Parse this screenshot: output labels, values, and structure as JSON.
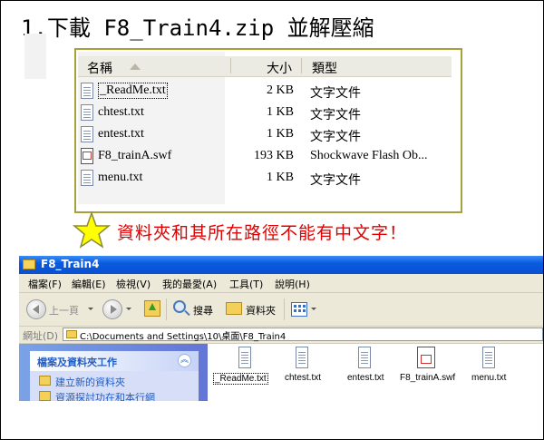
{
  "heading": "1.下載 F8_Train4.zip 並解壓縮",
  "file_list": {
    "columns": {
      "name": "名稱",
      "size": "大小",
      "type": "類型"
    },
    "rows": [
      {
        "name": "_ReadMe.txt",
        "size": "2 KB",
        "type": "文字文件",
        "icon": "text-file-icon"
      },
      {
        "name": "chtest.txt",
        "size": "1 KB",
        "type": "文字文件",
        "icon": "text-file-icon"
      },
      {
        "name": "entest.txt",
        "size": "1 KB",
        "type": "文字文件",
        "icon": "text-file-icon"
      },
      {
        "name": "F8_trainA.swf",
        "size": "193 KB",
        "type": "Shockwave Flash Ob...",
        "icon": "flash-file-icon"
      },
      {
        "name": "menu.txt",
        "size": "1 KB",
        "type": "文字文件",
        "icon": "text-file-icon"
      }
    ]
  },
  "note": "資料夾和其所在路徑不能有中文字！",
  "note_color": "#e00000",
  "explorer": {
    "title": "F8_Train4",
    "menu": [
      "檔案(F)",
      "編輯(E)",
      "檢視(V)",
      "我的最愛(A)",
      "工具(T)",
      "說明(H)"
    ],
    "toolbar": {
      "back": "上一頁",
      "search": "搜尋",
      "folders": "資料夾"
    },
    "address_label": "網址(D)",
    "address": "C:\\Documents and Settings\\10\\桌面\\F8_Train4",
    "task_pane": {
      "title": "檔案及資料夾工作",
      "tasks": [
        "建立新的資料夾",
        "資源探討功在和本行網"
      ]
    },
    "files": [
      "_ReadMe.txt",
      "chtest.txt",
      "entest.txt",
      "F8_trainA.swf",
      "menu.txt"
    ]
  }
}
